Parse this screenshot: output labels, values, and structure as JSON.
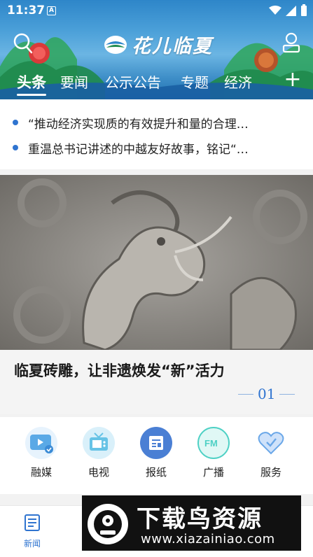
{
  "status": {
    "time": "11:37",
    "notification_badge": "A"
  },
  "app": {
    "logo_text": "花儿临夏"
  },
  "tabs": [
    {
      "label": "头条",
      "active": true
    },
    {
      "label": "要闻",
      "active": false
    },
    {
      "label": "公示公告",
      "active": false
    },
    {
      "label": "专题",
      "active": false
    },
    {
      "label": "经济",
      "active": false
    }
  ],
  "tab_add_label": "+",
  "ticker": [
    {
      "text": "“推动经济实现质的有效提升和量的合理…"
    },
    {
      "text": "重温总书记讲述的中越友好故事，铭记“…"
    }
  ],
  "banner": {
    "title": "临夏砖雕，让非遗焕发“新”活力",
    "index": "01"
  },
  "services": [
    {
      "label": "融媒",
      "icon": "media-icon",
      "color": "#5aa9e6"
    },
    {
      "label": "电视",
      "icon": "tv-icon",
      "color": "#67c3e6"
    },
    {
      "label": "报纸",
      "icon": "newspaper-icon",
      "color": "#4a7fd4"
    },
    {
      "label": "广播",
      "icon": "radio-fm-icon",
      "color": "#4fd1c5"
    },
    {
      "label": "服务",
      "icon": "service-heart-icon",
      "color": "#6aa7e8"
    }
  ],
  "bottom_nav": [
    {
      "label": "新闻",
      "icon": "news-icon",
      "active": true
    }
  ],
  "watermark": {
    "title": "下载鸟资源",
    "url": "www.xiazainiao.com"
  },
  "colors": {
    "accent": "#2f74d0",
    "header": "#2e86c9"
  }
}
